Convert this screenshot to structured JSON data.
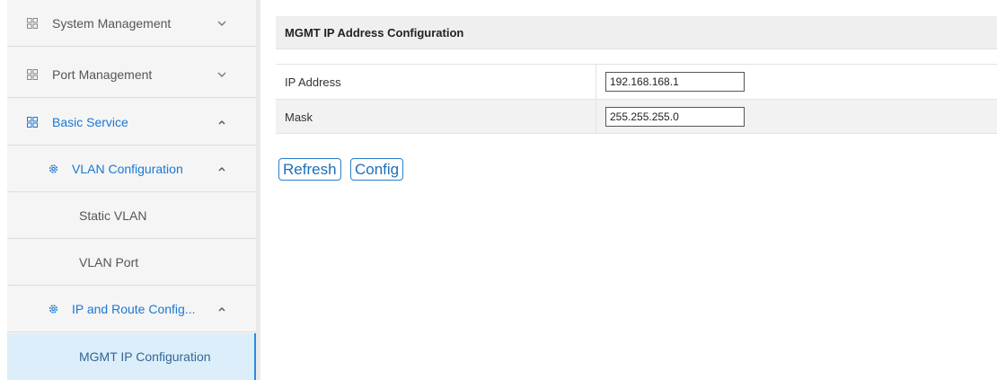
{
  "sidebar": {
    "items": [
      {
        "label": "System Management",
        "icon": "grid-icon",
        "chevron": "down"
      },
      {
        "label": "Port Management",
        "icon": "grid-icon",
        "chevron": "down"
      },
      {
        "label": "Basic Service",
        "icon": "grid-icon",
        "chevron": "up"
      },
      {
        "label": "VLAN Configuration",
        "icon": "gear-icon",
        "chevron": "up"
      },
      {
        "label": "Static VLAN"
      },
      {
        "label": "VLAN Port"
      },
      {
        "label": "IP and Route Config...",
        "icon": "gear-icon",
        "chevron": "up"
      },
      {
        "label": "MGMT IP Configuration"
      }
    ]
  },
  "panel": {
    "title": "MGMT IP Address Configuration",
    "rows": [
      {
        "label": "IP Address",
        "value": "192.168.168.1"
      },
      {
        "label": "Mask",
        "value": "255.255.255.0"
      }
    ]
  },
  "buttons": {
    "refresh": "Refresh",
    "config": "Config"
  },
  "colors": {
    "accent": "#1a78d4",
    "selected_bg": "#dceef9",
    "header_bg": "#efefef"
  }
}
